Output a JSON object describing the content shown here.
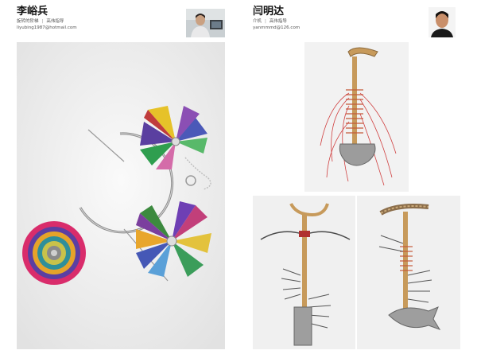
{
  "designers": [
    {
      "name": "李峪兵",
      "subtitle_work": "旋转的阶梯",
      "subtitle_advisor": "高伟指导",
      "email": "liyubing1987@hotmail.com"
    },
    {
      "name": "闫明达",
      "subtitle_work": "介机",
      "subtitle_advisor": "高伟指导",
      "email": "yanmmmd@126.com"
    }
  ]
}
